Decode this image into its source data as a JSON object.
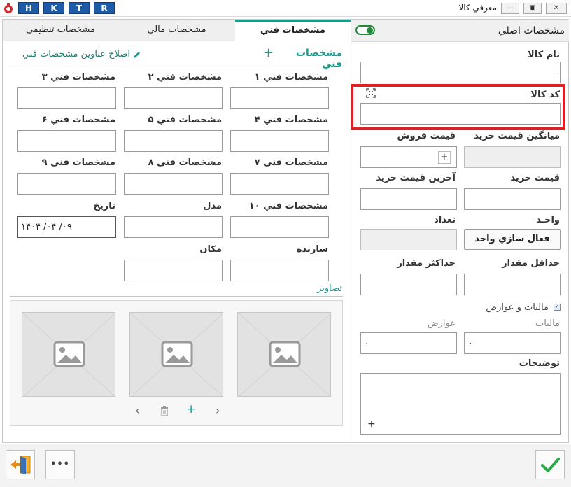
{
  "window": {
    "title": "معرفي كالا",
    "quick_buttons": [
      "H",
      "K",
      "T",
      "R"
    ],
    "minimize_glyph": "—",
    "restore_glyph": "▣",
    "close_glyph": "✕"
  },
  "tabs": {
    "technical": "مشخصات فني",
    "financial": "مشخصات مالي",
    "settings": "مشخصات تنظيمي"
  },
  "technical": {
    "header": "مشخصات فني",
    "add_glyph": "+",
    "edit_titles_link": "اصلاح عناوين مشخصات فني",
    "fields": [
      {
        "label": "مشخصات فني ۱",
        "value": ""
      },
      {
        "label": "مشخصات فني ۲",
        "value": ""
      },
      {
        "label": "مشخصات فني ۳",
        "value": ""
      },
      {
        "label": "مشخصات فني ۴",
        "value": ""
      },
      {
        "label": "مشخصات فني ۵",
        "value": ""
      },
      {
        "label": "مشخصات فني ۶",
        "value": ""
      },
      {
        "label": "مشخصات فني ۷",
        "value": ""
      },
      {
        "label": "مشخصات فني ۸",
        "value": ""
      },
      {
        "label": "مشخصات فني ۹",
        "value": ""
      },
      {
        "label": "مشخصات فني ۱۰",
        "value": ""
      },
      {
        "label": "مدل",
        "value": ""
      },
      {
        "label": "تاريخ",
        "value": "۱۴۰۴  /۰۴  /۰۹"
      },
      {
        "label": "سازنده",
        "value": ""
      },
      {
        "label": "مكان",
        "value": ""
      }
    ],
    "images_title": "تصاوير",
    "images_nav": {
      "prev": "‹",
      "delete": "🗑",
      "add": "+",
      "next": "›"
    }
  },
  "main_specs": {
    "header": "مشخصات اصلي",
    "toggle_on": true,
    "name_label": "نام كالا",
    "name_value": "",
    "code_label": "كد كالا",
    "code_value": "",
    "avg_purchase_label": "ميانگين قيمت خريد",
    "sale_price_label": "قيمت فروش",
    "sale_price_add": "+",
    "purchase_price_label": "قيمت خريد",
    "last_purchase_label": "آخرين قيمت خريد",
    "unit_label": "واحـد",
    "activate_unit_button": "فعال سازي واحد",
    "quantity_label": "تعداد",
    "min_qty_label": "حداقل مقدار",
    "max_qty_label": "حداكثر مقدار",
    "tax_checkbox_label": "ماليات و عوارض",
    "tax_checked": true,
    "tax_label": "ماليات",
    "duties_label": "عوارض",
    "tax_value": "۰",
    "duties_value": "۰",
    "description_label": "توضيحات",
    "description_add": "+"
  },
  "bottom": {
    "more_glyph": "•••"
  },
  "colors": {
    "accent": "#1a9a8a",
    "highlight": "#e01e24",
    "brand_blue": "#1e5aa6",
    "ok_green": "#2aa84a"
  }
}
